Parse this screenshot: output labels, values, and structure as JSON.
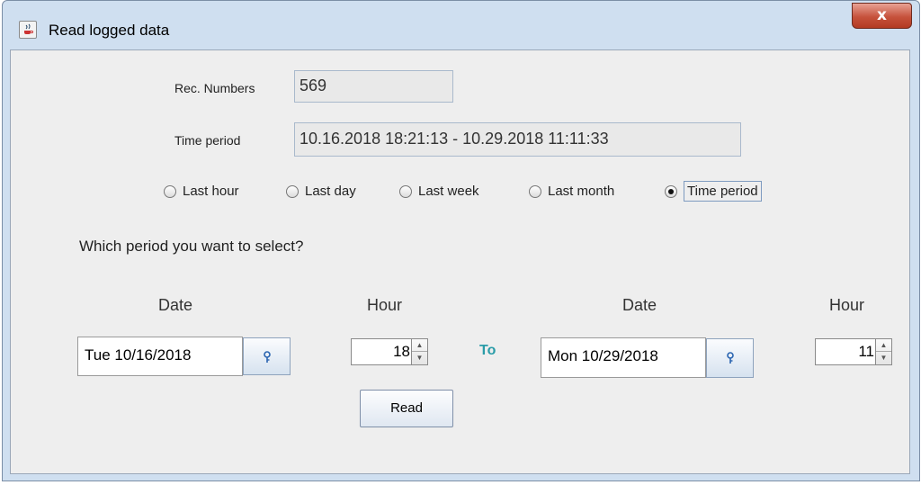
{
  "window": {
    "title": "Read logged data",
    "close_label": "x"
  },
  "rec_numbers": {
    "label": "Rec. Numbers",
    "value": "569"
  },
  "time_period_field": {
    "label": "Time period",
    "value": "10.16.2018 18:21:13 - 10.29.2018 11:11:33"
  },
  "range_options": [
    {
      "label": "Last hour",
      "selected": false
    },
    {
      "label": "Last day",
      "selected": false
    },
    {
      "label": "Last week",
      "selected": false
    },
    {
      "label": "Last month",
      "selected": false
    },
    {
      "label": "Time period",
      "selected": true
    }
  ],
  "question": "Which period you want to select?",
  "from": {
    "date_header": "Date",
    "hour_header": "Hour",
    "date_value": "Tue 10/16/2018",
    "hour_value": "18"
  },
  "to_label": "To",
  "to": {
    "date_header": "Date",
    "hour_header": "Hour",
    "date_value": "Mon 10/29/2018",
    "hour_value": "11"
  },
  "read_button": "Read",
  "icons": {
    "app": "java-cup-icon",
    "date_picker": "key-icon",
    "spinner_up": "caret-up-icon",
    "spinner_down": "caret-down-icon"
  },
  "colors": {
    "to_label": "#2a9ca8",
    "close_button": "#c6523c"
  }
}
